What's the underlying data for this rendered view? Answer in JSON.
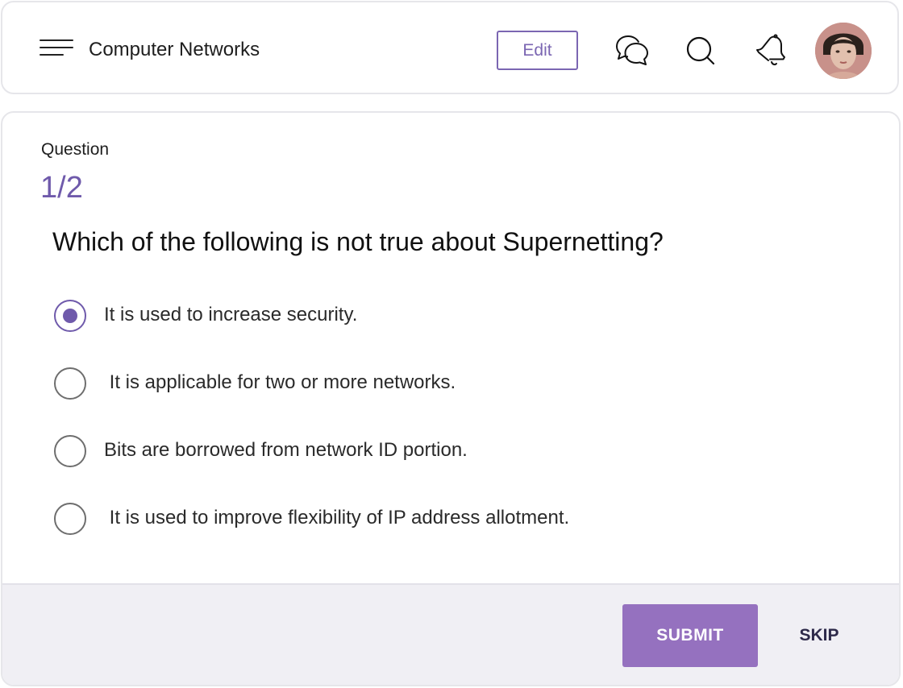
{
  "header": {
    "title": "Computer Networks",
    "edit_label": "Edit",
    "icons": [
      "menu-icon",
      "chat-icon",
      "search-icon",
      "bell-icon",
      "avatar"
    ]
  },
  "question": {
    "label": "Question",
    "counter": "1/2",
    "text": "Which of the following is not true about Supernetting?",
    "options": [
      {
        "label": "It is used to increase security.",
        "selected": true
      },
      {
        "label": " It is applicable for two or more networks.",
        "selected": false
      },
      {
        "label": "Bits are borrowed from network ID portion.",
        "selected": false
      },
      {
        "label": " It is used to improve flexibility of IP address allotment.",
        "selected": false
      }
    ]
  },
  "footer": {
    "submit_label": "SUBMIT",
    "skip_label": "SKIP"
  },
  "colors": {
    "accent": "#6f5aab",
    "submit_bg": "#9571bf",
    "footer_bg": "#f0eff4"
  }
}
